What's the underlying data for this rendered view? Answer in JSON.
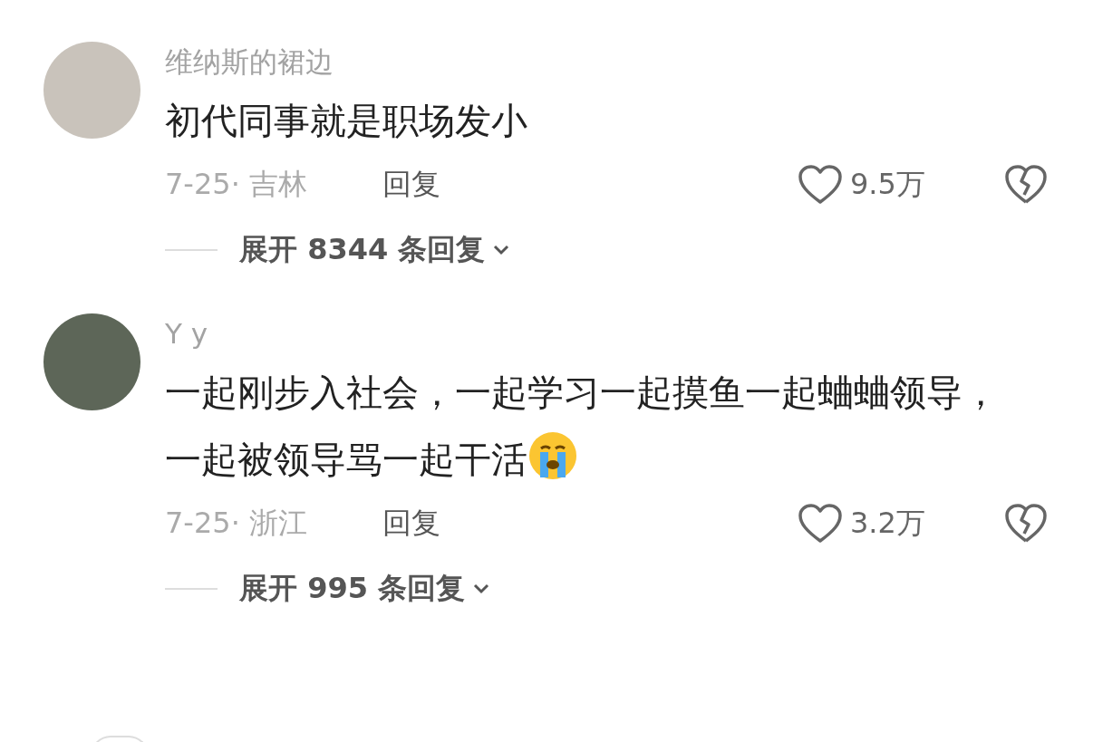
{
  "comments": [
    {
      "username": "维纳斯的裙边",
      "text": "初代同事就是职场发小",
      "crying_emoji": false,
      "meta": "7-25· 吉林",
      "reply": "回复",
      "likes": "9.5万",
      "expand": "展开 8344 条回复"
    },
    {
      "username": "Y y",
      "text": "一起刚步入社会，一起学习一起摸鱼一起蛐蛐领导，一起被领导骂一起干活",
      "crying_emoji": true,
      "meta": "7-25· 浙江",
      "reply": "回复",
      "likes": "3.2万",
      "expand": "展开 995 条回复"
    }
  ]
}
